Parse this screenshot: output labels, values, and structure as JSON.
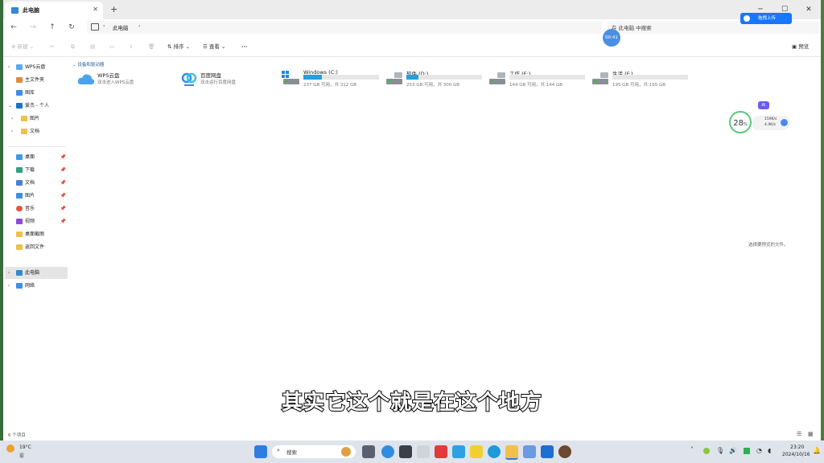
{
  "window": {
    "tab_title": "此电脑",
    "tab_close": "✕",
    "new_tab": "+",
    "minimize": "─",
    "maximize": "☐",
    "close": "✕"
  },
  "address": {
    "location": "此电脑",
    "chevron": "›",
    "search_placeholder": "在 此电脑 中搜索"
  },
  "toolbar": {
    "new_label": "新建",
    "sort_label": "排序",
    "view_label": "查看",
    "more_label": "···",
    "details_label": "预览"
  },
  "sidebar": {
    "top": [
      {
        "label": "WPS云盘",
        "chevron": "›"
      },
      {
        "label": "主文件夹",
        "chevron": ""
      },
      {
        "label": "图库",
        "chevron": ""
      },
      {
        "label": "爱杰 - 个人",
        "chevron": "⌄"
      },
      {
        "label": "图片",
        "chevron": "›"
      },
      {
        "label": "文档",
        "chevron": "›"
      }
    ],
    "quick": [
      {
        "label": "桌面",
        "pin": "📌"
      },
      {
        "label": "下载",
        "pin": "📌"
      },
      {
        "label": "文档",
        "pin": "📌"
      },
      {
        "label": "图片",
        "pin": "📌"
      },
      {
        "label": "音乐",
        "pin": "📌"
      },
      {
        "label": "视频",
        "pin": "📌"
      },
      {
        "label": "桌面截图",
        "pin": ""
      },
      {
        "label": "返回文件",
        "pin": ""
      }
    ],
    "bottom": [
      {
        "label": "此电脑",
        "chevron": "›",
        "selected": true
      },
      {
        "label": "网络",
        "chevron": "›",
        "selected": false
      }
    ]
  },
  "content": {
    "group_header": "⌄ 设备和驱动器",
    "cloud": [
      {
        "name": "WPS云盘",
        "desc": "双击进入WPS云盘"
      },
      {
        "name": "百度网盘",
        "desc": "双击运行百度网盘"
      }
    ],
    "drives": [
      {
        "name": "Windows (C:)",
        "free": "237 GB 可用，共 312 GB",
        "used_fraction": 0.24
      },
      {
        "name": "软件 (D:)",
        "free": "253 GB 可用，共 300 GB",
        "used_fraction": 0.16
      },
      {
        "name": "工作 (E:)",
        "free": "144 GB 可用，共 144 GB",
        "used_fraction": 0.0
      },
      {
        "name": "生活 (F:)",
        "free": "195 GB 可用，共 195 GB",
        "used_fraction": 0.0
      }
    ],
    "empty_hint": "选择要预览的文件。"
  },
  "status": {
    "count": "6 个项目"
  },
  "overlay": {
    "baidu_upload": "拖拽上传",
    "timer": "00:41",
    "widget_percent": "28",
    "widget_percent_unit": "%",
    "widget_up": "159K/s",
    "widget_down": "4.4K/s",
    "ai_badge": "AI"
  },
  "caption": "其实它这个就是在这个地方",
  "taskbar": {
    "weather_temp": "19°C",
    "weather_desc": "雾",
    "search_label": "搜索",
    "time": "23:20",
    "date": "2024/10/16"
  },
  "colors": {
    "accent": "#26a0da",
    "selected": "#e5e5e5",
    "group_header": "#2b5f9e"
  }
}
